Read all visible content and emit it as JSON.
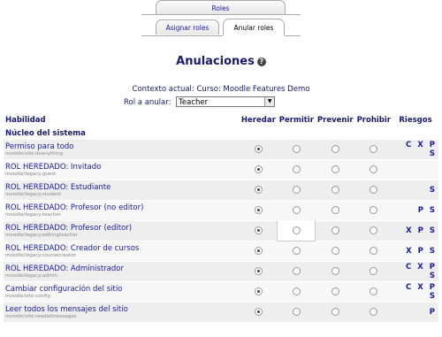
{
  "tabs": {
    "main": "Roles",
    "sub": [
      "Asignar roles",
      "Anular roles"
    ]
  },
  "page": {
    "title": "Anulaciones",
    "context_label": "Contexto actual:",
    "context_link": "Curso: Moodle Features Demo",
    "role_label": "Rol a anular:",
    "role_value": "Teacher"
  },
  "table": {
    "headers": {
      "capability": "Habilidad",
      "inherit": "Heredar",
      "allow": "Permitir",
      "prevent": "Prevenir",
      "prohibit": "Prohibir",
      "risks": "Riesgos"
    },
    "section": "Núcleo del sistema",
    "rows": [
      {
        "name": "Permiso para todo",
        "id": "moodle/site:doanything",
        "selected": 0,
        "risks": "C X P S"
      },
      {
        "name": "ROL HEREDADO: Invitado",
        "id": "moodle/legacy:guest",
        "selected": 0,
        "risks": ""
      },
      {
        "name": "ROL HEREDADO: Estudiante",
        "id": "moodle/legacy:student",
        "selected": 0,
        "risks": "S"
      },
      {
        "name": "ROL HEREDADO: Profesor (no editor)",
        "id": "moodle/legacy:teacher",
        "selected": 0,
        "risks": "P S"
      },
      {
        "name": "ROL HEREDADO: Profesor (editor)",
        "id": "moodle/legacy:editingteacher",
        "selected": 0,
        "risks": "X P S"
      },
      {
        "name": "ROL HEREDADO: Creador de cursos",
        "id": "moodle/legacy:coursecreator",
        "selected": 0,
        "risks": "X P S"
      },
      {
        "name": "ROL HEREDADO: Administrador",
        "id": "moodle/legacy:admin",
        "selected": 0,
        "risks": "C X P S"
      },
      {
        "name": "Cambiar configuración del sitio",
        "id": "moodle/site:config",
        "selected": 0,
        "risks": "C X P S"
      },
      {
        "name": "Leer todos los mensajes del sitio",
        "id": "moodle/site:readallmessages",
        "selected": 0,
        "risks": "P"
      }
    ]
  }
}
